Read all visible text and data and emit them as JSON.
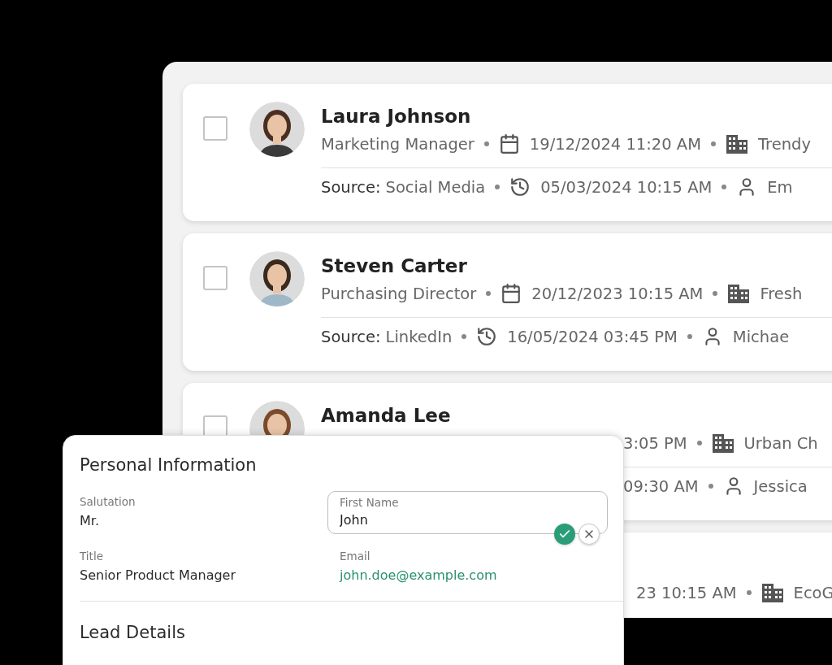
{
  "leads": [
    {
      "name": "Laura Johnson",
      "checked": false,
      "covered": false,
      "details": [
        {
          "kind": "text",
          "text": "Marketing Manager"
        },
        {
          "kind": "date",
          "text": "19/12/2024 11:20 AM"
        },
        {
          "kind": "company",
          "text": "Trendy"
        }
      ],
      "meta": [
        {
          "kind": "source",
          "label": "Source:",
          "text": "Social Media"
        },
        {
          "kind": "history",
          "text": "05/03/2024 10:15 AM"
        },
        {
          "kind": "owner",
          "text": "Em"
        }
      ]
    },
    {
      "name": "Steven Carter",
      "checked": false,
      "covered": false,
      "details": [
        {
          "kind": "text",
          "text": "Purchasing Director"
        },
        {
          "kind": "date",
          "text": "20/12/2023 10:15 AM"
        },
        {
          "kind": "company",
          "text": "Fresh"
        }
      ],
      "meta": [
        {
          "kind": "source",
          "label": "Source:",
          "text": "LinkedIn"
        },
        {
          "kind": "history",
          "text": "16/05/2024 03:45 PM"
        },
        {
          "kind": "owner",
          "text": "Michae"
        }
      ]
    },
    {
      "name": "Amanda Lee",
      "checked": false,
      "covered": true,
      "details": [
        {
          "kind": "text",
          "text": "3:05 PM"
        },
        {
          "kind": "company",
          "text": "Urban Ch"
        }
      ],
      "meta": [
        {
          "kind": "text",
          "text": "09:30 AM"
        },
        {
          "kind": "owner",
          "text": "Jessica"
        }
      ]
    },
    {
      "covered": true,
      "details": [
        {
          "kind": "text",
          "text": "23 10:15 AM"
        },
        {
          "kind": "company",
          "text": "EcoG"
        }
      ]
    }
  ],
  "form": {
    "title": "Personal Information",
    "fields": [
      {
        "kind": "static",
        "label": "Salutation",
        "value": "Mr."
      },
      {
        "kind": "editing",
        "label": "First Name",
        "value": "John"
      },
      {
        "kind": "static",
        "label": "Title",
        "value": "Senior Product Manager"
      },
      {
        "kind": "link",
        "label": "Email",
        "value": "john.doe@example.com"
      }
    ],
    "next_section": "Lead Details"
  }
}
